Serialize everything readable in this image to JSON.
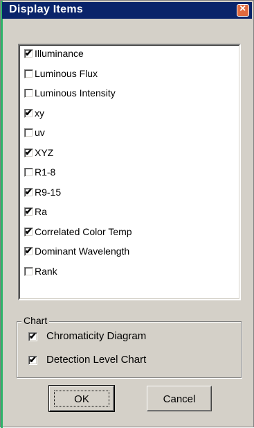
{
  "window": {
    "title": "Display Items"
  },
  "items": [
    {
      "label": "Illuminance",
      "checked": true
    },
    {
      "label": "Luminous Flux",
      "checked": false
    },
    {
      "label": "Luminous Intensity",
      "checked": false
    },
    {
      "label": "xy",
      "checked": true
    },
    {
      "label": "uv",
      "checked": false
    },
    {
      "label": "XYZ",
      "checked": true
    },
    {
      "label": "R1-8",
      "checked": false
    },
    {
      "label": "R9-15",
      "checked": true
    },
    {
      "label": "Ra",
      "checked": true
    },
    {
      "label": "Correlated Color Temp",
      "checked": true
    },
    {
      "label": "Dominant Wavelength",
      "checked": true
    },
    {
      "label": "Rank",
      "checked": false
    }
  ],
  "chart_group": {
    "title": "Chart",
    "options": [
      {
        "label": "Chromaticity Diagram",
        "checked": true
      },
      {
        "label": "Detection Level Chart",
        "checked": true
      }
    ]
  },
  "buttons": {
    "ok": "OK",
    "cancel": "Cancel"
  },
  "check_glyph": "✔"
}
